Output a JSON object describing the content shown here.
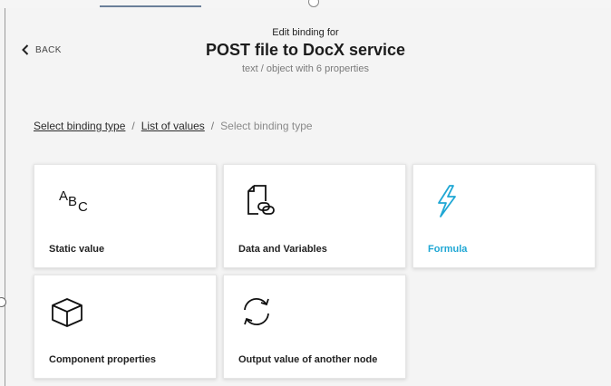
{
  "header": {
    "eyebrow": "Edit binding for",
    "title": "POST file to DocX service",
    "subtitle": "text / object with 6 properties"
  },
  "back": {
    "label": "BACK",
    "icon": "chevron-left-icon"
  },
  "breadcrumb": {
    "items": [
      "Select binding type",
      "List of values",
      "Select binding type"
    ],
    "separator": "/"
  },
  "cards": [
    {
      "label": "Static value",
      "icon": "abc-text-icon"
    },
    {
      "label": "Data and Variables",
      "icon": "document-link-icon"
    },
    {
      "label": "Formula",
      "icon": "lightning-icon"
    },
    {
      "label": "Component properties",
      "icon": "cube-icon"
    },
    {
      "label": "Output value of another node",
      "icon": "refresh-cycle-icon"
    }
  ],
  "colors": {
    "accent": "#1fa7d4",
    "background": "#f4f4f4",
    "card": "#ffffff"
  }
}
